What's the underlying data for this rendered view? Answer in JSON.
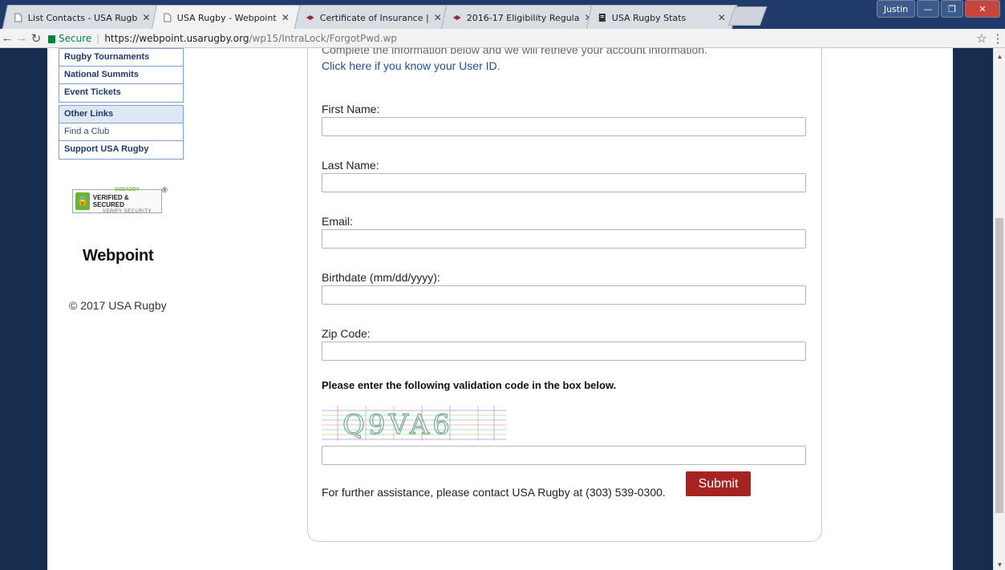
{
  "browser": {
    "tabs": [
      {
        "title": "List Contacts - USA Rugb",
        "icon": "page-icon"
      },
      {
        "title": "USA Rugby - Webpoint",
        "icon": "page-icon"
      },
      {
        "title": "Certificate of Insurance |",
        "icon": "usarugby-icon"
      },
      {
        "title": "2016-17 Eligibility Regula",
        "icon": "usarugby-icon"
      },
      {
        "title": "USA Rugby Stats",
        "icon": "document-icon"
      }
    ],
    "user": "Justin",
    "secure_label": "Secure",
    "url_host": "https://webpoint.usarugby.org",
    "url_path": "/wp15/IntraLock/ForgotPwd.wp"
  },
  "sidebar": {
    "group1": [
      "Rugby Tournaments",
      "National Summits",
      "Event Tickets"
    ],
    "group2": {
      "header": "Other Links",
      "items": [
        "Find a Club",
        "Support USA Rugby"
      ]
    },
    "badge": {
      "line1": "GODADDY",
      "line2": "VERIFIED & SECURED",
      "line3": "VERIFY SECURITY",
      "reg": "®"
    },
    "logo": "Webpoint",
    "copyright": "© 2017 USA Rugby"
  },
  "form": {
    "intro_cut": "Complete the information below and we will retrieve your account information.",
    "userid_link": "Click here if you know your User ID.",
    "fields": [
      {
        "label": "First Name:",
        "value": ""
      },
      {
        "label": "Last Name:",
        "value": ""
      },
      {
        "label": "Email:",
        "value": ""
      },
      {
        "label": "Birthdate (mm/dd/yyyy):",
        "value": ""
      },
      {
        "label": "Zip Code:",
        "value": ""
      }
    ],
    "validation_note": "Please enter the following validation code in the box below.",
    "captcha_text": "Q9VA6",
    "validation_value": "",
    "assist_text": "For further assistance, please contact USA Rugby at (303) 539-0300.",
    "submit_label": "Submit"
  },
  "colors": {
    "navy": "#172d4f",
    "submit": "#a52422",
    "link": "#1f4f9a"
  }
}
